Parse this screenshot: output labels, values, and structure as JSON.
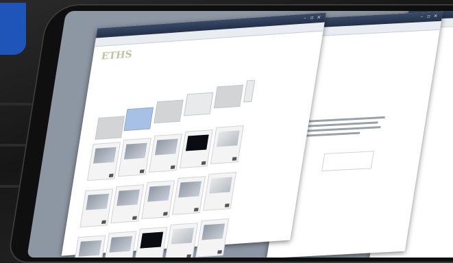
{
  "window_controls": {
    "minimize": "–",
    "maximize": "▫",
    "close": "×"
  },
  "top_links": "",
  "logo": "ETHS",
  "folders": [
    {
      "label": ""
    },
    {
      "label": ""
    },
    {
      "label": ""
    },
    {
      "label": ""
    },
    {
      "label": ""
    },
    {
      "label": ""
    }
  ],
  "tiles": [
    {
      "caption": "",
      "style": "normal"
    },
    {
      "caption": "",
      "style": "normal"
    },
    {
      "caption": "",
      "style": "normal"
    },
    {
      "caption": "",
      "style": "dark"
    },
    {
      "caption": "",
      "style": "light"
    },
    {
      "caption": "",
      "style": "normal"
    },
    {
      "caption": "",
      "style": "normal"
    },
    {
      "caption": "",
      "style": "normal"
    },
    {
      "caption": "",
      "style": "normal"
    },
    {
      "caption": "",
      "style": "light"
    },
    {
      "caption": "",
      "style": "normal"
    },
    {
      "caption": "",
      "style": "normal"
    },
    {
      "caption": "",
      "style": "dark"
    },
    {
      "caption": "",
      "style": "light"
    },
    {
      "caption": "",
      "style": "normal"
    }
  ],
  "colors": {
    "accent_blue": "#1f55b8",
    "folder_blue": "#a7c1e6",
    "titlebar": "#233048"
  }
}
